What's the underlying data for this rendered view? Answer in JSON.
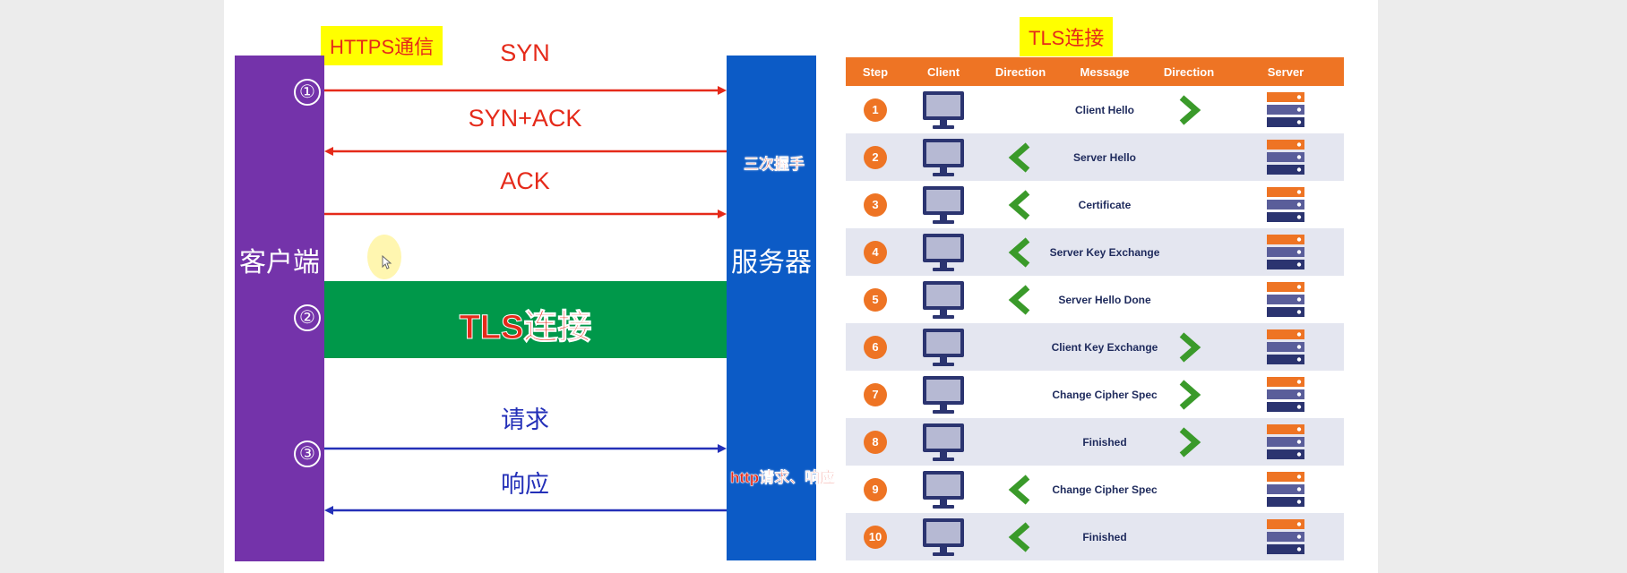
{
  "left": {
    "title": "HTTPS通信",
    "client_label": "客户端",
    "server_label": "服务器",
    "steps": [
      "①",
      "②",
      "③"
    ],
    "arrows": [
      {
        "label": "SYN",
        "dir": "right",
        "color": "#e52a1a"
      },
      {
        "label": "SYN+ACK",
        "dir": "left",
        "color": "#e52a1a"
      },
      {
        "label": "ACK",
        "dir": "right",
        "color": "#e52a1a"
      },
      {
        "label": "请求",
        "dir": "right",
        "color": "#2430b8"
      },
      {
        "label": "响应",
        "dir": "left",
        "color": "#2430b8"
      }
    ],
    "tls_band": "TLS连接",
    "handshake_note": "三次握手",
    "http_note": "http请求、响应"
  },
  "right": {
    "title": "TLS连接",
    "headers": [
      "Step",
      "Client",
      "Direction",
      "Message",
      "Direction",
      "Server"
    ],
    "rows": [
      {
        "step": "1",
        "message": "Client Hello",
        "direction": "to-server"
      },
      {
        "step": "2",
        "message": "Server Hello",
        "direction": "to-client"
      },
      {
        "step": "3",
        "message": "Certificate",
        "direction": "to-client"
      },
      {
        "step": "4",
        "message": "Server Key Exchange",
        "direction": "to-client"
      },
      {
        "step": "5",
        "message": "Server Hello Done",
        "direction": "to-client"
      },
      {
        "step": "6",
        "message": "Client Key Exchange",
        "direction": "to-server"
      },
      {
        "step": "7",
        "message": "Change Cipher Spec",
        "direction": "to-server"
      },
      {
        "step": "8",
        "message": "Finished",
        "direction": "to-server"
      },
      {
        "step": "9",
        "message": "Change Cipher Spec",
        "direction": "to-client"
      },
      {
        "step": "10",
        "message": "Finished",
        "direction": "to-client"
      }
    ]
  },
  "colors": {
    "client_bar": "#7433aa",
    "server_bar": "#0c5bc6",
    "tls_band": "#00984a",
    "table_header": "#ee7424",
    "direction_arrow": "#3a9a2a"
  }
}
